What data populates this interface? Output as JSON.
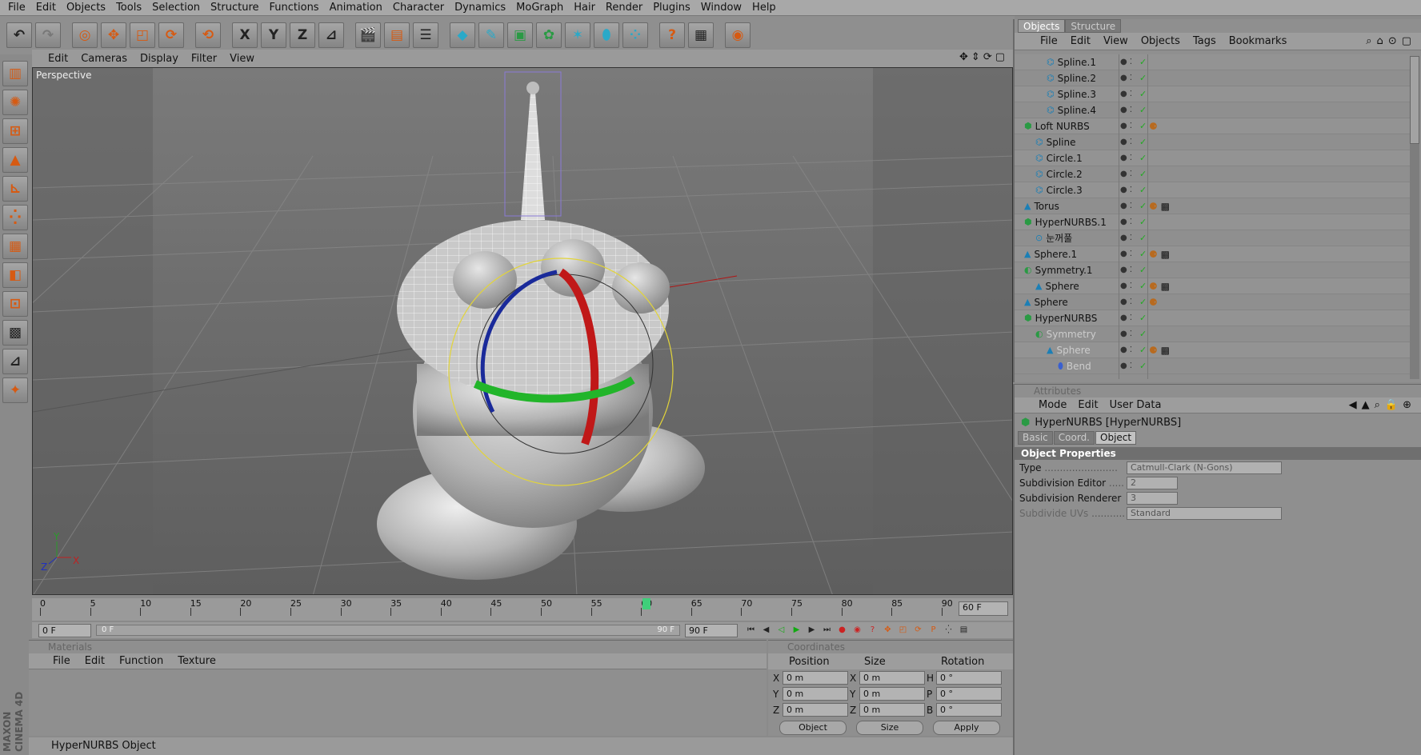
{
  "menu": [
    "File",
    "Edit",
    "Objects",
    "Tools",
    "Selection",
    "Structure",
    "Functions",
    "Animation",
    "Character",
    "Dynamics",
    "MoGraph",
    "Hair",
    "Render",
    "Plugins",
    "Window",
    "Help"
  ],
  "toolbar": {
    "axis_x": "X",
    "axis_y": "Y",
    "axis_z": "Z"
  },
  "viewport": {
    "menu": [
      "Edit",
      "Cameras",
      "Display",
      "Filter",
      "View"
    ],
    "label": "Perspective",
    "axis_x": "X",
    "axis_y": "Y",
    "axis_z": "Z"
  },
  "timeline": {
    "ticks": [
      "0",
      "5",
      "10",
      "15",
      "20",
      "25",
      "30",
      "35",
      "40",
      "45",
      "50",
      "55",
      "60",
      "65",
      "70",
      "75",
      "80",
      "85",
      "90"
    ],
    "current_frame": "60 F",
    "start_field": "0 F",
    "range_start": "0 F",
    "range_end": "90 F",
    "end_field": "90 F"
  },
  "materials": {
    "title": "Materials",
    "menu": [
      "File",
      "Edit",
      "Function",
      "Texture"
    ]
  },
  "coordinates": {
    "title": "Coordinates",
    "headers": [
      "Position",
      "Size",
      "Rotation"
    ],
    "rows": [
      {
        "pos_label": "X",
        "pos": "0 m",
        "size_label": "X",
        "size": "0 m",
        "rot_label": "H",
        "rot": "0 °"
      },
      {
        "pos_label": "Y",
        "pos": "0 m",
        "size_label": "Y",
        "size": "0 m",
        "rot_label": "P",
        "rot": "0 °"
      },
      {
        "pos_label": "Z",
        "pos": "0 m",
        "size_label": "Z",
        "size": "0 m",
        "rot_label": "B",
        "rot": "0 °"
      }
    ],
    "mode": "Object",
    "size_mode": "Size",
    "apply": "Apply"
  },
  "status": "HyperNURBS Object",
  "brand": "MAXON CINEMA 4D",
  "objects": {
    "tabs": [
      "Objects",
      "Structure"
    ],
    "menu": [
      "File",
      "Edit",
      "View",
      "Objects",
      "Tags",
      "Bookmarks"
    ],
    "tree": [
      {
        "name": "Spline.1",
        "indent": 40,
        "icon": "spline",
        "tags": ""
      },
      {
        "name": "Spline.2",
        "indent": 40,
        "icon": "spline",
        "tags": ""
      },
      {
        "name": "Spline.3",
        "indent": 40,
        "icon": "spline",
        "tags": ""
      },
      {
        "name": "Spline.4",
        "indent": 40,
        "icon": "spline",
        "tags": ""
      },
      {
        "name": "Loft NURBS",
        "indent": 12,
        "icon": "loft",
        "tags": "mat"
      },
      {
        "name": "Spline",
        "indent": 26,
        "icon": "spline",
        "tags": ""
      },
      {
        "name": "Circle.1",
        "indent": 26,
        "icon": "spline",
        "tags": ""
      },
      {
        "name": "Circle.2",
        "indent": 26,
        "icon": "spline",
        "tags": ""
      },
      {
        "name": "Circle.3",
        "indent": 26,
        "icon": "spline",
        "tags": ""
      },
      {
        "name": "Torus",
        "indent": 12,
        "icon": "prim",
        "tags": "mat tex"
      },
      {
        "name": "HyperNURBS.1",
        "indent": 12,
        "icon": "hyper",
        "tags": ""
      },
      {
        "name": "눈꺼풀",
        "indent": 26,
        "icon": "null",
        "tags": ""
      },
      {
        "name": "Sphere.1",
        "indent": 12,
        "icon": "prim",
        "tags": "mat tex"
      },
      {
        "name": "Symmetry.1",
        "indent": 12,
        "icon": "sym",
        "tags": ""
      },
      {
        "name": "Sphere",
        "indent": 26,
        "icon": "prim",
        "tags": "mat tex"
      },
      {
        "name": "Sphere",
        "indent": 12,
        "icon": "prim",
        "tags": "mat"
      },
      {
        "name": "HyperNURBS",
        "indent": 12,
        "icon": "hyper",
        "tags": ""
      },
      {
        "name": "Symmetry",
        "indent": 26,
        "icon": "sym",
        "tags": "",
        "dim": true
      },
      {
        "name": "Sphere",
        "indent": 40,
        "icon": "prim",
        "tags": "mat tex",
        "dim": true
      },
      {
        "name": "Bend",
        "indent": 54,
        "icon": "deform",
        "tags": "",
        "dim": true
      }
    ]
  },
  "attributes": {
    "title": "Attributes",
    "menu": [
      "Mode",
      "Edit",
      "User Data"
    ],
    "object_title": "HyperNURBS [HyperNURBS]",
    "tabs": [
      "Basic",
      "Coord.",
      "Object"
    ],
    "section": "Object Properties",
    "props": [
      {
        "label": "Type",
        "value": "Catmull-Clark (N-Gons)",
        "width": 194
      },
      {
        "label": "Subdivision Editor",
        "value": "2",
        "width": 64
      },
      {
        "label": "Subdivision Renderer",
        "value": "3",
        "width": 64
      },
      {
        "label": "Subdivide UVs",
        "value": "Standard",
        "width": 194,
        "dim": true
      }
    ]
  }
}
